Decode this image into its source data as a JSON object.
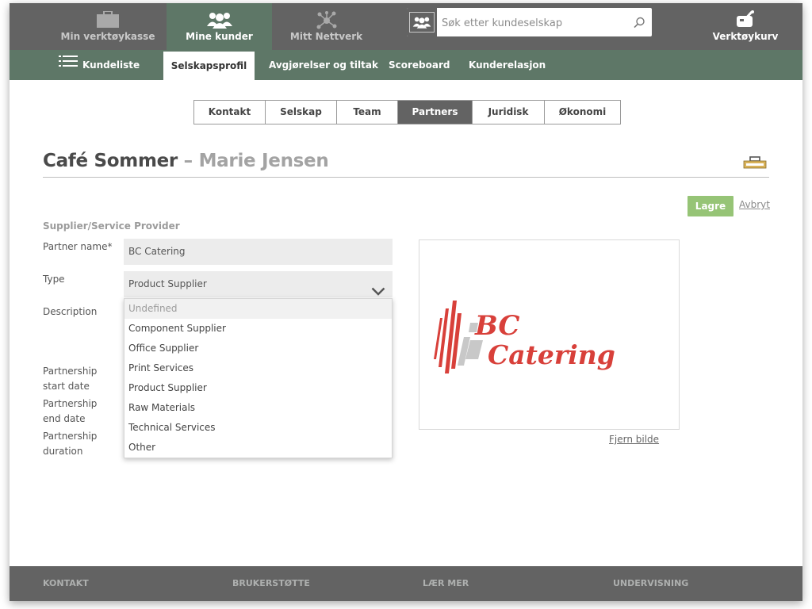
{
  "topnav": {
    "items": [
      {
        "label": "Min verktøykasse",
        "icon": "toolbox-icon"
      },
      {
        "label": "Mine kunder",
        "icon": "people-icon",
        "active": true
      },
      {
        "label": "Mitt Nettverk",
        "icon": "network-icon"
      }
    ],
    "search": {
      "placeholder": "Søk etter kundeselskap",
      "icon": "search-icon"
    },
    "basket": {
      "label": "Verktøykurv",
      "icon": "basket-icon"
    }
  },
  "subnav": {
    "items": [
      {
        "label": "Kundeliste",
        "icon": "list-icon"
      },
      {
        "label": "Selskapsprofil",
        "active": true
      },
      {
        "label": "Avgjørelser og tiltak"
      },
      {
        "label": "Scoreboard"
      },
      {
        "label": "Kunderelasjon"
      }
    ]
  },
  "tabs": [
    {
      "label": "Kontakt"
    },
    {
      "label": "Selskap"
    },
    {
      "label": "Team"
    },
    {
      "label": "Partners",
      "active": true
    },
    {
      "label": "Juridisk"
    },
    {
      "label": "Økonomi"
    }
  ],
  "page": {
    "company": "Café Sommer",
    "separator": "–",
    "person": "Marie Jensen"
  },
  "actions": {
    "save": "Lagre",
    "cancel": "Avbryt"
  },
  "form": {
    "section_title": "Supplier/Service Provider",
    "labels": {
      "partner_name": "Partner name*",
      "type": "Type",
      "description": "Description",
      "start_date_l1": "Partnership",
      "start_date_l2": "start date",
      "end_date_l1": "Partnership",
      "end_date_l2": "end date",
      "duration_l1": "Partnership",
      "duration_l2": "duration"
    },
    "partner_name_value": "BC Catering",
    "type_value": "Product Supplier",
    "type_options": [
      "Undefined",
      "Component Supplier",
      "Office Supplier",
      "Print Services",
      "Product Supplier",
      "Raw Materials",
      "Technical Services",
      "Other"
    ]
  },
  "logo": {
    "line1": "BC",
    "line2": "Catering",
    "color": "#d8403a"
  },
  "remove_image": "Fjern bilde",
  "footer": {
    "items": [
      "KONTAKT",
      "BRUKERSTØTTE",
      "LÆR MER",
      "UNDERVISNING"
    ]
  },
  "colors": {
    "topbar": "#636363",
    "accent_green": "#5e7767",
    "save_green": "#96c476"
  }
}
